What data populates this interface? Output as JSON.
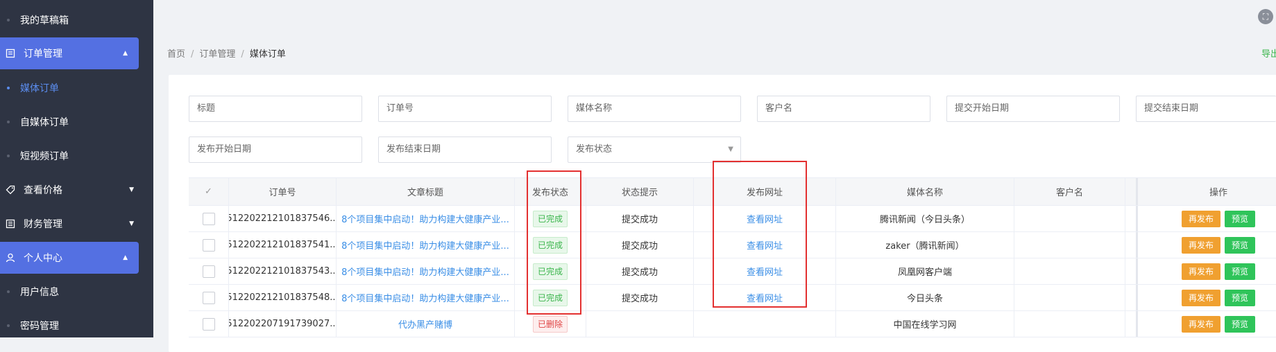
{
  "sidebar": {
    "items": [
      {
        "label": "我的草稿箱"
      },
      {
        "label": "订单管理"
      },
      {
        "label": "媒体订单"
      },
      {
        "label": "自媒体订单"
      },
      {
        "label": "短视频订单"
      },
      {
        "label": "查看价格"
      },
      {
        "label": "财务管理"
      },
      {
        "label": "个人中心"
      },
      {
        "label": "用户信息"
      },
      {
        "label": "密码管理"
      }
    ]
  },
  "breadcrumb": {
    "home": "首页",
    "sep": "/",
    "level1": "订单管理",
    "current": "媒体订单"
  },
  "export_label": "导出",
  "filters": {
    "title": "标题",
    "order_no": "订单号",
    "media_name": "媒体名称",
    "customer": "客户名",
    "submit_start": "提交开始日期",
    "submit_end": "提交结束日期",
    "publish_start": "发布开始日期",
    "publish_end": "发布结束日期",
    "publish_status": "发布状态"
  },
  "table": {
    "headers": {
      "check": "✓",
      "order_no": "订单号",
      "title": "文章标题",
      "status": "发布状态",
      "hint": "状态提示",
      "url": "发布网址",
      "media": "媒体名称",
      "customer": "客户名",
      "actions": "操作"
    },
    "rows": [
      {
        "order_no": "512202212101837546...",
        "title": "8个项目集中启动！助力构建大健康产业...",
        "status": "已完成",
        "hint": "提交成功",
        "url": "查看网址",
        "media": "腾讯新闻（今日头条）",
        "customer": ""
      },
      {
        "order_no": "512202212101837541...",
        "title": "8个项目集中启动！助力构建大健康产业...",
        "status": "已完成",
        "hint": "提交成功",
        "url": "查看网址",
        "media": "zaker（腾讯新闻）",
        "customer": ""
      },
      {
        "order_no": "512202212101837543...",
        "title": "8个项目集中启动！助力构建大健康产业...",
        "status": "已完成",
        "hint": "提交成功",
        "url": "查看网址",
        "media": "凤凰网客户端",
        "customer": ""
      },
      {
        "order_no": "512202212101837548...",
        "title": "8个项目集中启动！助力构建大健康产业...",
        "status": "已完成",
        "hint": "提交成功",
        "url": "查看网址",
        "media": "今日头条",
        "customer": ""
      },
      {
        "order_no": "512202207191739027...",
        "title": "代办黑产赌博",
        "status": "已删除",
        "hint": "",
        "url": "",
        "media": "中国在线学习网",
        "customer": ""
      }
    ],
    "action_republish": "再发布",
    "action_preview": "预览"
  },
  "colors": {
    "sidebar_bg": "#2e3443",
    "sidebar_active": "#5470e2",
    "link": "#3a8ee6",
    "success": "#39b54a",
    "danger": "#e04545",
    "orange": "#f0a030",
    "green": "#2fc45a",
    "highlight_box": "#e33030"
  }
}
